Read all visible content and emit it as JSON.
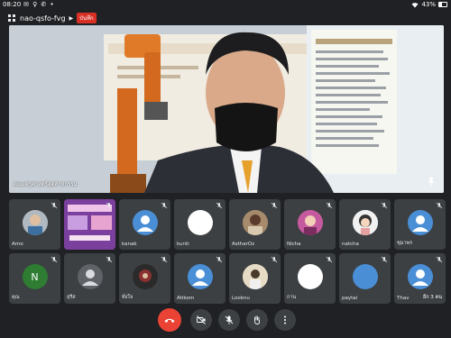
{
  "status_bar": {
    "time": "08:20",
    "icons": "✉ ♀ ✆ •",
    "battery": "43%"
  },
  "meeting": {
    "code": "nao-qsfo-fvg",
    "recording_label": "บันทึก"
  },
  "main_speaker": {
    "name": "คณะครุศาสตร์อุตสาหกรรม"
  },
  "participants_row1": [
    {
      "name": "Arno",
      "avatar_type": "photo",
      "avatar_color": "#9aa0a6"
    },
    {
      "name": "",
      "avatar_type": "screen",
      "avatar_color": "#a14fb0"
    },
    {
      "name": "kanak",
      "avatar_type": "person",
      "avatar_color": "#4a8fd6"
    },
    {
      "name": "kunti",
      "avatar_type": "blank",
      "avatar_color": "#ffffff"
    },
    {
      "name": "AstharOz",
      "avatar_type": "photo",
      "avatar_color": "#8a6f5a"
    },
    {
      "name": "Nicha",
      "avatar_type": "photo",
      "avatar_color": "#b04a8a"
    },
    {
      "name": "natcha",
      "avatar_type": "cartoon",
      "avatar_color": "#f1f1f1"
    },
    {
      "name": "ชุมาพร",
      "avatar_type": "person",
      "avatar_color": "#4a8fd6"
    }
  ],
  "participants_row2": [
    {
      "name": "คุณ",
      "avatar_type": "letter",
      "avatar_letter": "N",
      "avatar_color": "#2e7d32"
    },
    {
      "name": "สุรีส",
      "avatar_type": "person",
      "avatar_color": "#5f6368"
    },
    {
      "name": "ทั่งใจ",
      "avatar_type": "photo",
      "avatar_color": "#3a3a3a"
    },
    {
      "name": "Atikom",
      "avatar_type": "person",
      "avatar_color": "#4a8fd6"
    },
    {
      "name": "Looknu",
      "avatar_type": "photo",
      "avatar_color": "#d7c6a5"
    },
    {
      "name": "กาน",
      "avatar_type": "blank",
      "avatar_color": "#ffffff"
    },
    {
      "name": "paytai",
      "avatar_type": "blank",
      "avatar_color": "#4a8fd6"
    },
    {
      "name": "Thav",
      "avatar_type": "person",
      "avatar_color": "#4a8fd6",
      "more": "อีก 3 คน"
    }
  ],
  "controls": {
    "end_call": "end-call-icon",
    "camera": "camera-off-icon",
    "mic": "mic-off-icon",
    "hand": "raise-hand-icon",
    "more": "more-vert-icon"
  }
}
